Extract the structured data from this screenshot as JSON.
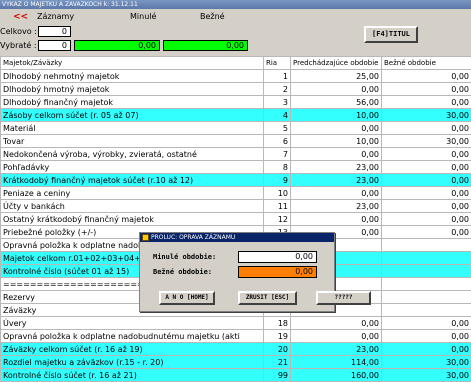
{
  "title": "VYKAZ O MAJETKU A ZAVAZKOCH k: 31.12.11",
  "header": {
    "arrow": "<<",
    "col1": "Záznamy",
    "col2": "Minulé",
    "col3": "Bežné"
  },
  "summary": {
    "celkovo_label": "Celkovo :",
    "celkovo_value": "0",
    "vybrate_label": "Vybraté :",
    "vybrate_count": "0",
    "vybrate_minule": "0,00",
    "vybrate_bezne": "0,00"
  },
  "titul_button": "[F4]TITUL",
  "table": {
    "headers": [
      "Majetok/Záväzky",
      "Ria",
      "Predchádzajúce obdobie",
      "Bežné obdobie"
    ],
    "rows": [
      {
        "name": "Dlhodobý nehmotný majetok",
        "ria": "1",
        "prev": "25,00",
        "curr": "0,00",
        "hl": false
      },
      {
        "name": "Dlhodobý hmotný majetok",
        "ria": "2",
        "prev": "0,00",
        "curr": "0,00",
        "hl": false
      },
      {
        "name": "Dlhodobý finančný majetok",
        "ria": "3",
        "prev": "56,00",
        "curr": "0,00",
        "hl": false
      },
      {
        "name": "Zásoby celkom súčet (r. 05 až 07)",
        "ria": "4",
        "prev": "10,00",
        "curr": "30,00",
        "hl": true
      },
      {
        "name": "Materiál",
        "ria": "5",
        "prev": "0,00",
        "curr": "0,00",
        "hl": false
      },
      {
        "name": "Tovar",
        "ria": "6",
        "prev": "10,00",
        "curr": "30,00",
        "hl": false
      },
      {
        "name": "Nedokončená výroba, výrobky, zvieratá, ostatné",
        "ria": "7",
        "prev": "0,00",
        "curr": "0,00",
        "hl": false
      },
      {
        "name": "Pohľadávky",
        "ria": "8",
        "prev": "23,00",
        "curr": "0,00",
        "hl": false
      },
      {
        "name": "Krátkodobý finančný majetok súčet (r.10 až 12)",
        "ria": "9",
        "prev": "23,00",
        "curr": "0,00",
        "hl": true
      },
      {
        "name": "Peniaze a ceniny",
        "ria": "10",
        "prev": "0,00",
        "curr": "0,00",
        "hl": false
      },
      {
        "name": "Účty v bankách",
        "ria": "11",
        "prev": "23,00",
        "curr": "0,00",
        "hl": false
      },
      {
        "name": "Ostatný krátkodobý finančný majetok",
        "ria": "12",
        "prev": "0,00",
        "curr": "0,00",
        "hl": false
      },
      {
        "name": "Priebežné položky (+/-)",
        "ria": "13",
        "prev": "0,00",
        "curr": "0,00",
        "hl": false
      },
      {
        "name": "Opravná položka k odplatne nadobu",
        "ria": "",
        "prev": "",
        "curr": "",
        "hl": false
      },
      {
        "name": "Majetok celkom r.01+02+03+04+08+",
        "ria": "",
        "prev": "",
        "curr": "",
        "hl": true
      },
      {
        "name": "Kontrolné číslo (súčet 01 až 15)",
        "ria": "",
        "prev": "",
        "curr": "",
        "hl": true
      },
      {
        "name": "=============================",
        "ria": "",
        "prev": "",
        "curr": "",
        "hl": false
      },
      {
        "name": "Rezervy",
        "ria": "",
        "prev": "",
        "curr": "",
        "hl": false
      },
      {
        "name": "Záväzky",
        "ria": "",
        "prev": "",
        "curr": "",
        "hl": false
      },
      {
        "name": "Úvery",
        "ria": "18",
        "prev": "0,00",
        "curr": "0,00",
        "hl": false
      },
      {
        "name": "Opravná položka k odplatne nadobudnutému majetku (akti",
        "ria": "19",
        "prev": "0,00",
        "curr": "0,00",
        "hl": false
      },
      {
        "name": "Záväzky celkom súčet (r. 16 až 19)",
        "ria": "20",
        "prev": "23,00",
        "curr": "0,00",
        "hl": true
      },
      {
        "name": "Rozdiel majetku a záväzkov (r.15 - r. 20)",
        "ria": "21",
        "prev": "114,00",
        "curr": "30,00",
        "hl": true
      },
      {
        "name": "Kontrolné číslo súčet (r. 16 až 21)",
        "ria": "99",
        "prev": "160,00",
        "curr": "30,00",
        "hl": true
      }
    ]
  },
  "dialog": {
    "title": "PROLUC: OPRAVA ZÁZNAMU",
    "minule_label": "Minulé obdobie:",
    "minule_value": "0,00",
    "bezne_label": "Bežné obdobie:",
    "bezne_value": "0,00",
    "btn_ano": "A N O [HOME]",
    "btn_zrusit": "ZRUSIT [ESC]",
    "btn_help": "?????"
  }
}
